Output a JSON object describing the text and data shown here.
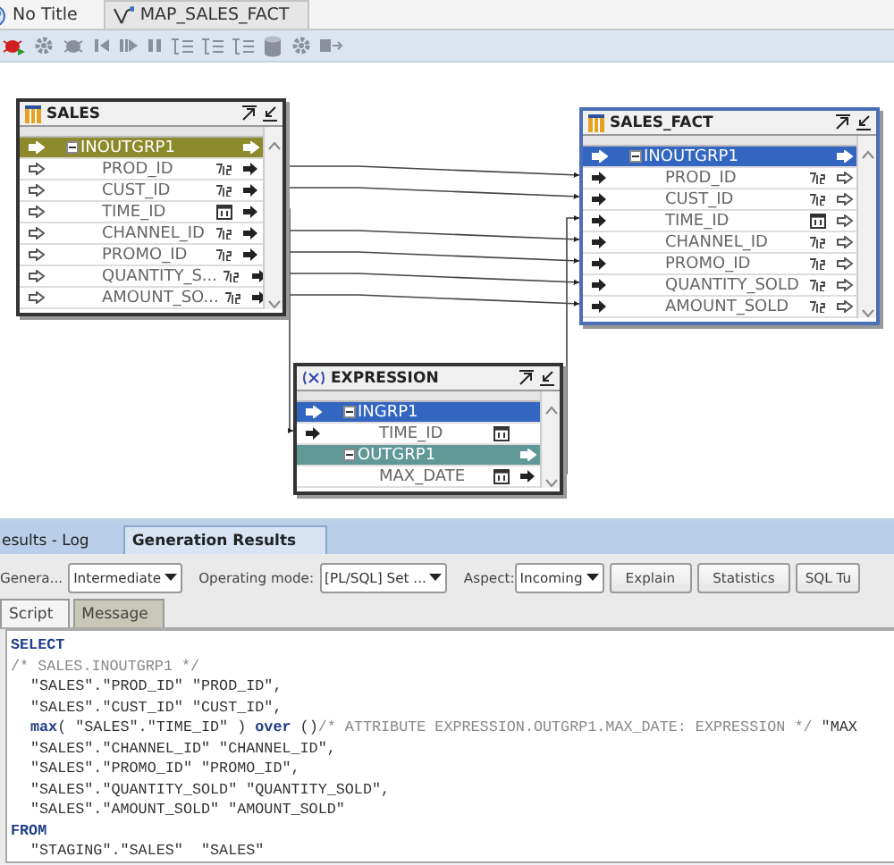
{
  "tabs": [
    {
      "label": "No Title",
      "selected": false
    },
    {
      "label": "MAP_SALES_FACT",
      "selected": true
    }
  ],
  "nodes": [
    {
      "title": "SALES",
      "kind": "table",
      "selected": false,
      "rows": [
        {
          "kind": "group",
          "name": "INOUTGRP1",
          "color": "#8c8a2c",
          "expanded": true,
          "input": true,
          "output": true
        },
        {
          "kind": "number",
          "name": "PROD_ID",
          "input": true,
          "output": true
        },
        {
          "kind": "number",
          "name": "CUST_ID",
          "input": true,
          "output": true
        },
        {
          "kind": "date",
          "name": "TIME_ID",
          "input": true,
          "output": true
        },
        {
          "kind": "number",
          "name": "CHANNEL_ID",
          "input": true,
          "output": true
        },
        {
          "kind": "number",
          "name": "PROMO_ID",
          "input": true,
          "output": true
        },
        {
          "kind": "number",
          "name": "QUANTITY_S...",
          "input": true,
          "output": true
        },
        {
          "kind": "number",
          "name": "AMOUNT_SO...",
          "input": true,
          "output": true
        }
      ]
    },
    {
      "title": "SALES_FACT",
      "kind": "table",
      "selected": true,
      "rows": [
        {
          "kind": "group",
          "name": "INOUTGRP1",
          "color": "#3366c0",
          "expanded": true,
          "input": true,
          "output": true
        },
        {
          "kind": "number",
          "name": "PROD_ID",
          "input": true,
          "output": true
        },
        {
          "kind": "number",
          "name": "CUST_ID",
          "input": true,
          "output": true
        },
        {
          "kind": "date",
          "name": "TIME_ID",
          "input": true,
          "output": true
        },
        {
          "kind": "number",
          "name": "CHANNEL_ID",
          "input": true,
          "output": true
        },
        {
          "kind": "number",
          "name": "PROMO_ID",
          "input": true,
          "output": true
        },
        {
          "kind": "number",
          "name": "QUANTITY_SOLD",
          "input": true,
          "output": true
        },
        {
          "kind": "number",
          "name": "AMOUNT_SOLD",
          "input": true,
          "output": true
        }
      ]
    },
    {
      "title": "EXPRESSION",
      "kind": "expression",
      "selected": false,
      "rows": [
        {
          "kind": "group",
          "name": "INGRP1",
          "color": "#3366c0",
          "expanded": true,
          "input": true,
          "output": false
        },
        {
          "kind": "date",
          "name": "TIME_ID",
          "input": true,
          "output": false
        },
        {
          "kind": "group",
          "name": "OUTGRP1",
          "color": "#5f9896",
          "expanded": true,
          "input": false,
          "output": true
        },
        {
          "kind": "date",
          "name": "MAX_DATE",
          "input": false,
          "output": true
        }
      ]
    }
  ],
  "results": {
    "tabs": [
      {
        "label": "esults - Log",
        "selected": false
      },
      {
        "label": "Generation Results",
        "selected": true
      }
    ],
    "toolbar": {
      "label": "Genera...",
      "generation_mode": "Intermediate",
      "operating_mode_label": "Operating mode:",
      "operating_mode": "[PL/SQL] Set ...",
      "aspect_label": "Aspect:",
      "aspect": "Incoming",
      "buttons": [
        "Explain",
        "Statistics",
        "SQL Tu"
      ]
    },
    "subtabs": [
      {
        "label": "Script",
        "selected": true
      },
      {
        "label": "Message",
        "selected": false
      }
    ],
    "script": [
      {
        "indent": false,
        "segments": [
          {
            "kind": "keyword",
            "text": "SELECT"
          }
        ]
      },
      {
        "indent": false,
        "segments": [
          {
            "kind": "comment",
            "text": "/* SALES.INOUTGRP1 */"
          }
        ]
      },
      {
        "indent": true,
        "segments": [
          {
            "kind": "plain",
            "text": "\"SALES\".\"PROD_ID\" \"PROD_ID\","
          }
        ]
      },
      {
        "indent": true,
        "segments": [
          {
            "kind": "plain",
            "text": "\"SALES\".\"CUST_ID\" \"CUST_ID\","
          }
        ]
      },
      {
        "indent": true,
        "segments": [
          {
            "kind": "keyword",
            "text": "max"
          },
          {
            "kind": "plain",
            "text": "( \"SALES\".\"TIME_ID\" ) "
          },
          {
            "kind": "keyword",
            "text": "over"
          },
          {
            "kind": "plain",
            "text": " ()"
          },
          {
            "kind": "comment",
            "text": "/* ATTRIBUTE EXPRESSION.OUTGRP1.MAX_DATE: EXPRESSION */"
          },
          {
            "kind": "plain",
            "text": " \"MAX"
          }
        ]
      },
      {
        "indent": true,
        "segments": [
          {
            "kind": "plain",
            "text": "\"SALES\".\"CHANNEL_ID\" \"CHANNEL_ID\","
          }
        ]
      },
      {
        "indent": true,
        "segments": [
          {
            "kind": "plain",
            "text": "\"SALES\".\"PROMO_ID\" \"PROMO_ID\","
          }
        ]
      },
      {
        "indent": true,
        "segments": [
          {
            "kind": "plain",
            "text": "\"SALES\".\"QUANTITY_SOLD\" \"QUANTITY_SOLD\","
          }
        ]
      },
      {
        "indent": true,
        "segments": [
          {
            "kind": "plain",
            "text": "\"SALES\".\"AMOUNT_SOLD\" \"AMOUNT_SOLD\""
          }
        ]
      },
      {
        "indent": false,
        "segments": [
          {
            "kind": "keyword",
            "text": "FROM"
          }
        ]
      },
      {
        "indent": true,
        "segments": [
          {
            "kind": "plain",
            "text": "\"STAGING\".\"SALES\"  \"SALES\""
          }
        ]
      }
    ]
  }
}
